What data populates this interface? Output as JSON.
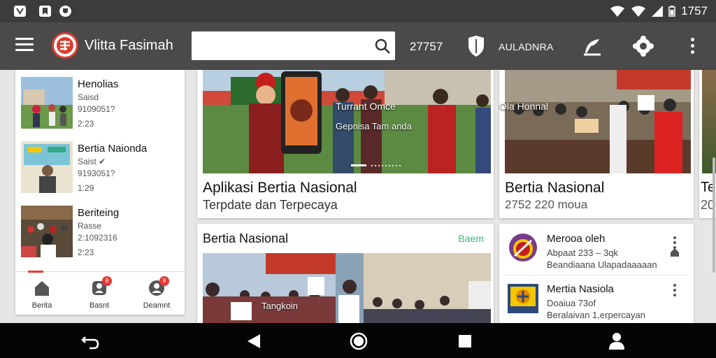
{
  "status_bar": {
    "time": "1757"
  },
  "app_bar": {
    "title": "Vlitta Fasimah",
    "search_placeholder": "",
    "count": "27757",
    "label": "AULADNRA"
  },
  "left_panel": {
    "items": [
      {
        "title": "Henolias",
        "line1": "Saisd",
        "line2": "9109051?",
        "line3": "2:23"
      },
      {
        "title": "Bertia Naionda",
        "line1": "Saist ✔",
        "line2": "9193051?",
        "line3": "1:29"
      },
      {
        "title": "Beriteing",
        "line1": "Rasse",
        "line2": "2:1092316",
        "line3": "2:23"
      }
    ],
    "nav": [
      {
        "label": "Berita",
        "badge": ""
      },
      {
        "label": "Basnt",
        "badge": "8"
      },
      {
        "label": "Deamnt",
        "badge": "8"
      }
    ]
  },
  "featured": {
    "overlay_line1": "Turrant Omce",
    "overlay_line2": "Gepnisa Tam anda",
    "title": "Aplikasi Bertia Nasional",
    "subtitle": "Terpdate dan Terpecaya"
  },
  "side_card": {
    "overlay": "Ola Honnal",
    "title": "Bertia Nasional",
    "subtitle": "2752 220 moua"
  },
  "edge_card": {
    "title": "Te",
    "subtitle": "20"
  },
  "section": {
    "title": "Bertia Nasional",
    "link": "Baem",
    "caption": "Tangkoin"
  },
  "list": [
    {
      "title": "Merooa oleh",
      "line1": "Abpaat 233 – 3qk",
      "line2": "Beandiaana Ulapadaaaaan"
    },
    {
      "title": "Mertia Nasiola",
      "line1": "Doaiua 73of",
      "line2": "Beralaivan 1,erpercayan"
    }
  ],
  "colors": {
    "accent": "#e53935",
    "appbar": "#4a4a4a",
    "link": "#3cb878"
  }
}
